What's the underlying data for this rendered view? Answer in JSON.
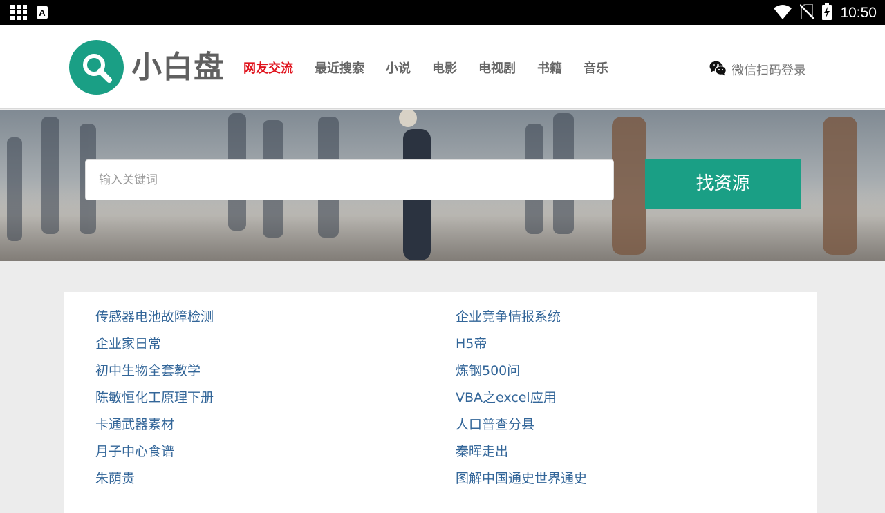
{
  "status_bar": {
    "time": "10:50",
    "icons": [
      "apps-grid-icon",
      "a-box-icon",
      "wifi-icon",
      "no-sim-icon",
      "battery-charging-icon"
    ]
  },
  "header": {
    "logo_text": "小白盘",
    "nav": [
      {
        "label": "网友交流",
        "active": true
      },
      {
        "label": "最近搜索",
        "active": false
      },
      {
        "label": "小说",
        "active": false
      },
      {
        "label": "电影",
        "active": false
      },
      {
        "label": "电视剧",
        "active": false
      },
      {
        "label": "书籍",
        "active": false
      },
      {
        "label": "音乐",
        "active": false
      }
    ],
    "login_label": "微信扫码登录"
  },
  "search": {
    "placeholder": "输入关键词",
    "value": "",
    "button_label": "找资源"
  },
  "list": {
    "left": [
      "传感器电池故障检测",
      "企业家日常",
      "初中生物全套教学",
      "陈敏恒化工原理下册",
      "卡通武器素材",
      "月子中心食谱",
      "朱荫贵"
    ],
    "right": [
      "企业竞争情报系统",
      "H5帝",
      "炼钢500问",
      "VBA之excel应用",
      "人口普查分县",
      "秦晖走出",
      "图解中国通史世界通史"
    ]
  },
  "colors": {
    "brand": "#1a9f85",
    "nav_active": "#e0131d",
    "link": "#336699"
  }
}
